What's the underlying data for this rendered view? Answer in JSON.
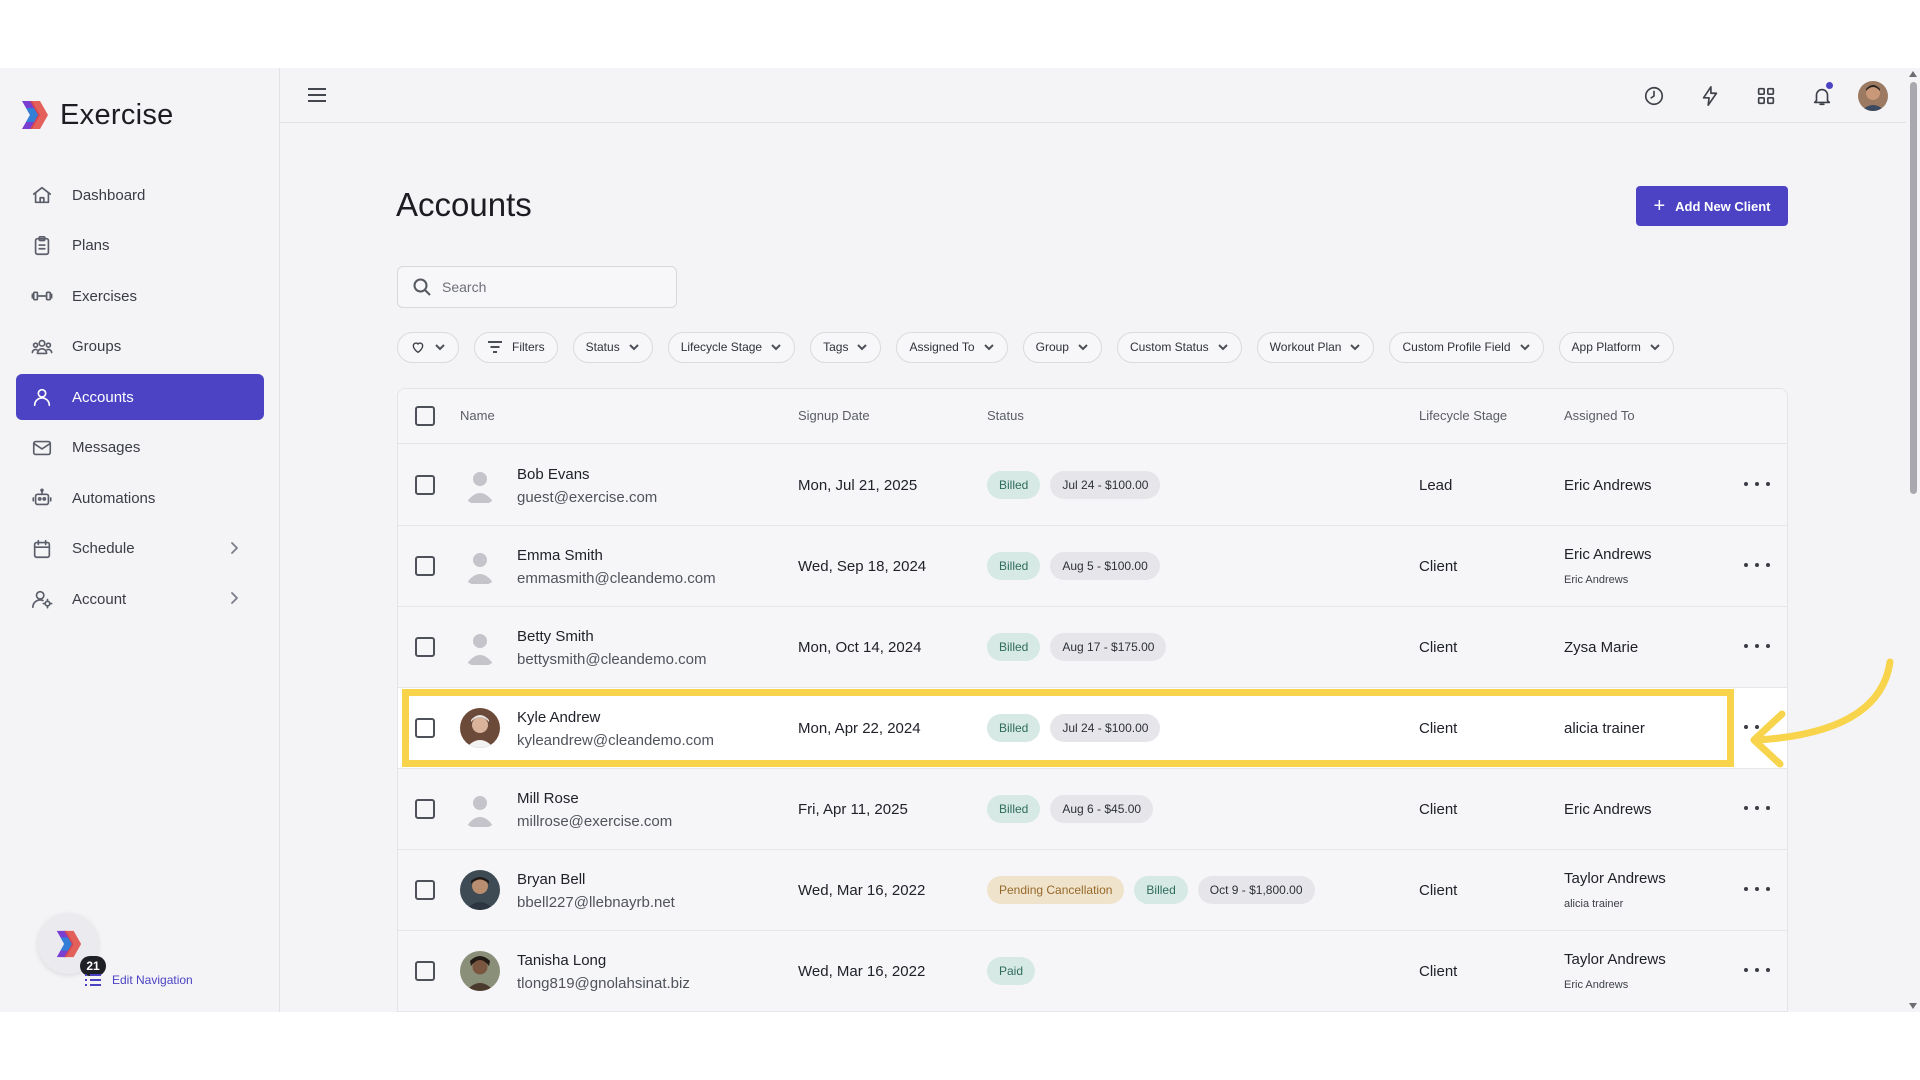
{
  "app": {
    "name": "Exercise"
  },
  "sidebar": {
    "items": [
      {
        "label": "Dashboard",
        "icon": "home-icon",
        "active": false,
        "chevron": false
      },
      {
        "label": "Plans",
        "icon": "clipboard-icon",
        "active": false,
        "chevron": false
      },
      {
        "label": "Exercises",
        "icon": "dumbbell-icon",
        "active": false,
        "chevron": false
      },
      {
        "label": "Groups",
        "icon": "users-icon",
        "active": false,
        "chevron": false
      },
      {
        "label": "Accounts",
        "icon": "user-icon",
        "active": true,
        "chevron": false
      },
      {
        "label": "Messages",
        "icon": "mail-icon",
        "active": false,
        "chevron": false
      },
      {
        "label": "Automations",
        "icon": "robot-icon",
        "active": false,
        "chevron": false
      },
      {
        "label": "Schedule",
        "icon": "calendar-icon",
        "active": false,
        "chevron": true
      },
      {
        "label": "Account",
        "icon": "user-gear-icon",
        "active": false,
        "chevron": true
      }
    ],
    "helper_badge": "21",
    "edit_navigation": "Edit Navigation"
  },
  "colors": {
    "accent": "#4b43c4",
    "highlight": "#f8d44c",
    "billed_bg": "#d6e9e4",
    "pending_bg": "#f0e3cc"
  },
  "main": {
    "title": "Accounts",
    "add_button": "Add New Client",
    "search": {
      "placeholder": "Search",
      "value": ""
    },
    "filters": [
      "Filters",
      "Status",
      "Lifecycle Stage",
      "Tags",
      "Assigned To",
      "Group",
      "Custom Status",
      "Workout Plan",
      "Custom Profile Field",
      "App Platform"
    ]
  },
  "table": {
    "columns": {
      "name": "Name",
      "signup": "Signup Date",
      "status": "Status",
      "lifecycle": "Lifecycle Stage",
      "assigned": "Assigned To"
    },
    "rows": [
      {
        "name": "Bob Evans",
        "email": "guest@exercise.com",
        "signup": "Mon, Jul 21, 2025",
        "badges": [
          {
            "text": "Billed",
            "kind": "billed"
          },
          {
            "text": "Jul 24 - $100.00",
            "kind": "period"
          }
        ],
        "lifecycle": "Lead",
        "assigned": "Eric Andrews",
        "assigned_sub": "",
        "avatar": "placeholder"
      },
      {
        "name": "Emma Smith",
        "email": "emmasmith@cleandemo.com",
        "signup": "Wed, Sep 18, 2024",
        "badges": [
          {
            "text": "Billed",
            "kind": "billed"
          },
          {
            "text": "Aug 5 - $100.00",
            "kind": "period"
          }
        ],
        "lifecycle": "Client",
        "assigned": "Eric Andrews",
        "assigned_sub": "Eric Andrews",
        "avatar": "placeholder"
      },
      {
        "name": "Betty Smith",
        "email": "bettysmith@cleandemo.com",
        "signup": "Mon, Oct 14, 2024",
        "badges": [
          {
            "text": "Billed",
            "kind": "billed"
          },
          {
            "text": "Aug 17 - $175.00",
            "kind": "period"
          }
        ],
        "lifecycle": "Client",
        "assigned": "Zysa Marie",
        "assigned_sub": "",
        "avatar": "placeholder"
      },
      {
        "name": "Kyle Andrew",
        "email": "kyleandrew@cleandemo.com",
        "signup": "Mon, Apr 22, 2024",
        "badges": [
          {
            "text": "Billed",
            "kind": "billed"
          },
          {
            "text": "Jul 24 - $100.00",
            "kind": "period"
          }
        ],
        "lifecycle": "Client",
        "assigned": "alicia trainer",
        "assigned_sub": "",
        "avatar": "photo",
        "highlight": true
      },
      {
        "name": "Mill Rose",
        "email": "millrose@exercise.com",
        "signup": "Fri, Apr 11, 2025",
        "badges": [
          {
            "text": "Billed",
            "kind": "billed"
          },
          {
            "text": "Aug 6 - $45.00",
            "kind": "period"
          }
        ],
        "lifecycle": "Client",
        "assigned": "Eric Andrews",
        "assigned_sub": "",
        "avatar": "placeholder"
      },
      {
        "name": "Bryan Bell",
        "email": "bbell227@llebnayrb.net",
        "signup": "Wed, Mar 16, 2022",
        "badges": [
          {
            "text": "Pending Cancellation",
            "kind": "pending"
          },
          {
            "text": "Billed",
            "kind": "billed"
          },
          {
            "text": "Oct 9 - $1,800.00",
            "kind": "period"
          }
        ],
        "lifecycle": "Client",
        "assigned": "Taylor Andrews",
        "assigned_sub": "alicia trainer",
        "avatar": "photo"
      },
      {
        "name": "Tanisha Long",
        "email": "tlong819@gnolahsinat.biz",
        "signup": "Wed, Mar 16, 2022",
        "badges": [
          {
            "text": "Paid",
            "kind": "paid"
          }
        ],
        "lifecycle": "Client",
        "assigned": "Taylor Andrews",
        "assigned_sub": "Eric Andrews",
        "avatar": "photo"
      }
    ]
  }
}
